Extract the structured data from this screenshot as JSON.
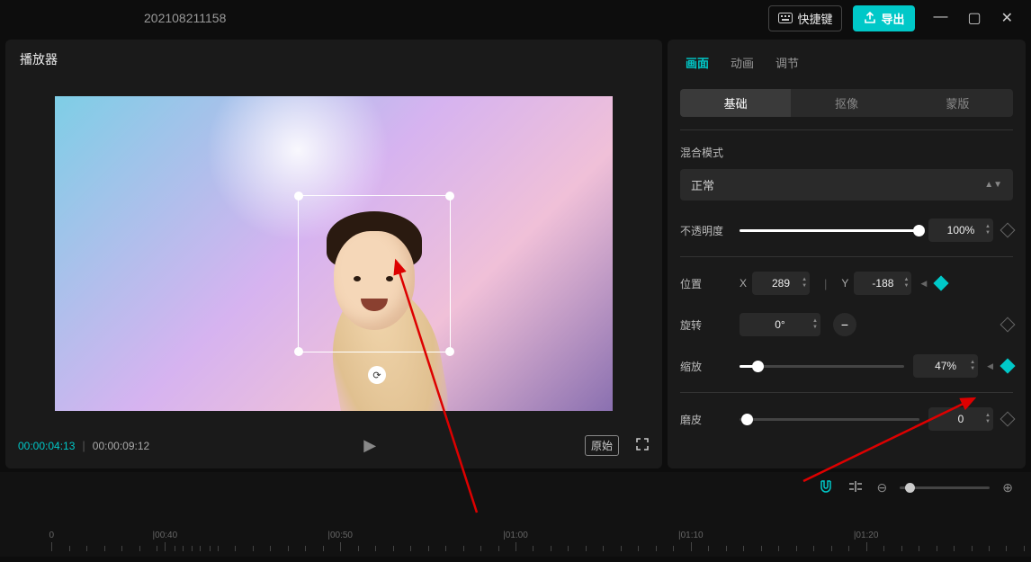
{
  "topbar": {
    "title": "202108211158",
    "shortcut_label": "快捷键",
    "export_label": "导出"
  },
  "player": {
    "header": "播放器",
    "time_current": "00:00:04:13",
    "time_total": "00:00:09:12",
    "ratio_label": "原始"
  },
  "props": {
    "tabs": [
      "画面",
      "动画",
      "调节"
    ],
    "active_tab": 0,
    "sub_tabs": [
      "基础",
      "抠像",
      "蒙版"
    ],
    "active_sub": 0,
    "blend_mode_label": "混合模式",
    "blend_mode_value": "正常",
    "opacity_label": "不透明度",
    "opacity_value": "100%",
    "opacity_pct": 100,
    "position_label": "位置",
    "pos_x_label": "X",
    "pos_x": "289",
    "pos_y_label": "Y",
    "pos_y": "-188",
    "rotation_label": "旋转",
    "rotation_value": "0°",
    "scale_label": "缩放",
    "scale_value": "47%",
    "scale_pct": 11,
    "smooth_skin_label": "磨皮",
    "smooth_skin_value": "0",
    "smooth_skin_pct": 4
  },
  "timeline": {
    "marks": [
      {
        "pos": 5,
        "label": "0"
      },
      {
        "pos": 16,
        "label": "|00:40"
      },
      {
        "pos": 33,
        "label": "|00:50"
      },
      {
        "pos": 50,
        "label": "|01:00"
      },
      {
        "pos": 67,
        "label": "|01:10"
      },
      {
        "pos": 84,
        "label": "|01:20"
      }
    ]
  }
}
